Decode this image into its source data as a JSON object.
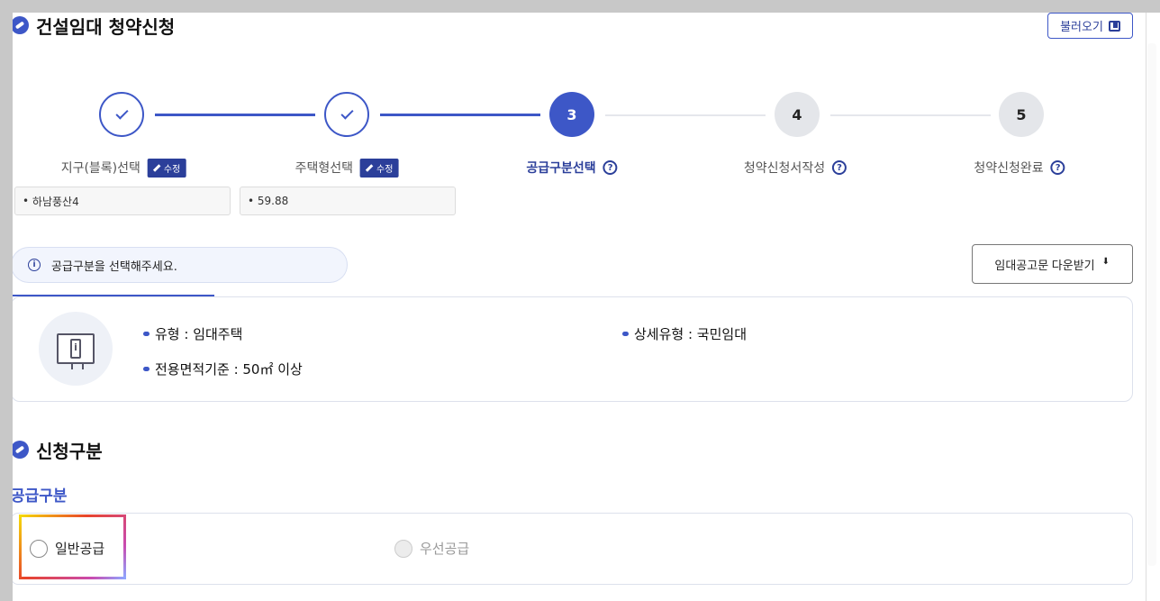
{
  "header": {
    "title": "건설임대 청약신청",
    "load_button": "불러오기"
  },
  "steps": [
    {
      "number": "1",
      "label": "지구(블록)선택",
      "state": "done",
      "badge": "수정"
    },
    {
      "number": "2",
      "label": "주택형선택",
      "state": "done",
      "badge": "수정"
    },
    {
      "number": "3",
      "label": "공급구분선택",
      "state": "active",
      "help": "?"
    },
    {
      "number": "4",
      "label": "청약신청서작성",
      "state": "pending",
      "help": "?"
    },
    {
      "number": "5",
      "label": "청약신청완료",
      "state": "pending",
      "help": "?"
    }
  ],
  "selections": {
    "district": "하남풍산4",
    "house_type": "59.88"
  },
  "notice": {
    "icon": "i",
    "text": "공급구분을 선택해주세요."
  },
  "download_button": "임대공고문 다운받기",
  "detail": {
    "type": "유형 : 임대주택",
    "sub_type": "상세유형 : 국민임대",
    "area": "전용면적기준 : 50㎡ 이상"
  },
  "apply_section": {
    "title": "신청구분",
    "supply_label": "공급구분",
    "options": [
      {
        "label": "일반공급",
        "enabled": true
      },
      {
        "label": "우선공급",
        "enabled": false
      }
    ]
  },
  "colors": {
    "accent": "#3d57c7",
    "accent_dark": "#2b3f9a",
    "pending": "#e4e6ea"
  },
  "icons": [
    "refresh-icon",
    "copy-icon",
    "check-icon",
    "pencil-icon",
    "help-icon",
    "info-icon",
    "download-icon",
    "kiosk-icon",
    "chevron-left-icon"
  ]
}
